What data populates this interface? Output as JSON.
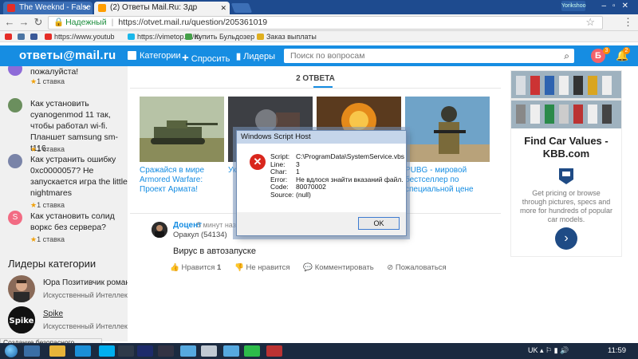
{
  "browser": {
    "tabs": [
      {
        "title": "The Weeknd - False Ale"
      },
      {
        "title": "(2) Ответы Mail.Ru: Здр"
      }
    ],
    "profile_label": "Yorikshoo",
    "address": {
      "secure_label": "Надежный",
      "url": "https://otvet.mail.ru/question/205361019"
    },
    "bookmarks": [
      {
        "label": "https://www.youtub",
        "icon": "youtube-icon",
        "color": "#e52d27"
      },
      {
        "label": "https://vimetop.ru/m",
        "icon": "vimeo-icon",
        "color": "#1ab7ea"
      },
      {
        "label": "Купить Бульдозер Г",
        "icon": "shop-icon",
        "color": "#45a049"
      },
      {
        "label": "Заказ выплаты",
        "icon": "coin-icon",
        "color": "#e0b020"
      }
    ],
    "status_text": "Создание безопасного подключения..."
  },
  "site": {
    "logo": "ответы@mail.ru",
    "nav": {
      "categories": "Категории",
      "ask": "Спросить",
      "leaders": "Лидеры"
    },
    "search_placeholder": "Поиск по вопросам",
    "user_initial": "Б",
    "user_badge": "3",
    "notif_badge": "2",
    "accent": "#168de2"
  },
  "sidebar": {
    "questions": [
      {
        "text": "пожалуйста!",
        "stars": "1 ставка",
        "avatar_color": "#8e6bd8"
      },
      {
        "text": "Как установить cyanogenmod 11 так, чтобы работал wi-fi. Планшет samsung sm-t116.",
        "stars": "1 ставка",
        "avatar_color": "#6b8f5e"
      },
      {
        "text": "Как устранить ошибку 0xc0000057? Не запускается игра the little nightmares",
        "stars": "1 ставка",
        "avatar_color": "#7a84a8"
      },
      {
        "text": "Как установить солид воркс без сервера?",
        "stars": "1 ставка",
        "avatar_color": "#f26b83",
        "initial": "S"
      }
    ],
    "leaders_title": "Лидеры категории",
    "leaders": [
      {
        "name": "Юра Позитивчик романтик",
        "rank": "Искусственный Интеллект"
      },
      {
        "name": "Spike",
        "rank": "Искусственный Интеллект"
      }
    ]
  },
  "main": {
    "answers_count": "2 ОТВЕТА",
    "cards": [
      {
        "caption": "Сражайся в мире Armored Warfare: Проект Армата!"
      },
      {
        "caption": "Ук"
      },
      {
        "caption": ""
      },
      {
        "caption": "PUBG - мировой бестселлер по специальной цене"
      }
    ],
    "answer": {
      "author": "Доцент",
      "time": "5 минут назад",
      "rank": "Оракул (54134)",
      "text": "Вирус в автозапуске",
      "actions": {
        "like": "Нравится",
        "like_count": "1",
        "dislike": "Не нравится",
        "comment": "Комментировать",
        "report": "Пожаловаться"
      }
    }
  },
  "ad": {
    "headline": "Find Car Values - KBB.com",
    "body": "Get pricing or browse through pictures, specs and more for hundreds of popular car models."
  },
  "dialog": {
    "title": "Windows Script Host",
    "fields": [
      {
        "key": "Script:",
        "value": "C:\\ProgramData\\SystemService.vbs"
      },
      {
        "key": "Line:",
        "value": "3"
      },
      {
        "key": "Char:",
        "value": "1"
      },
      {
        "key": "Error:",
        "value": "Не вдлося знайти вказаний файл."
      },
      {
        "key": "Code:",
        "value": "80070002"
      },
      {
        "key": "Source:",
        "value": "(null)"
      }
    ],
    "ok": "OK"
  },
  "taskbar": {
    "lang": "UK",
    "time": "11:59"
  }
}
